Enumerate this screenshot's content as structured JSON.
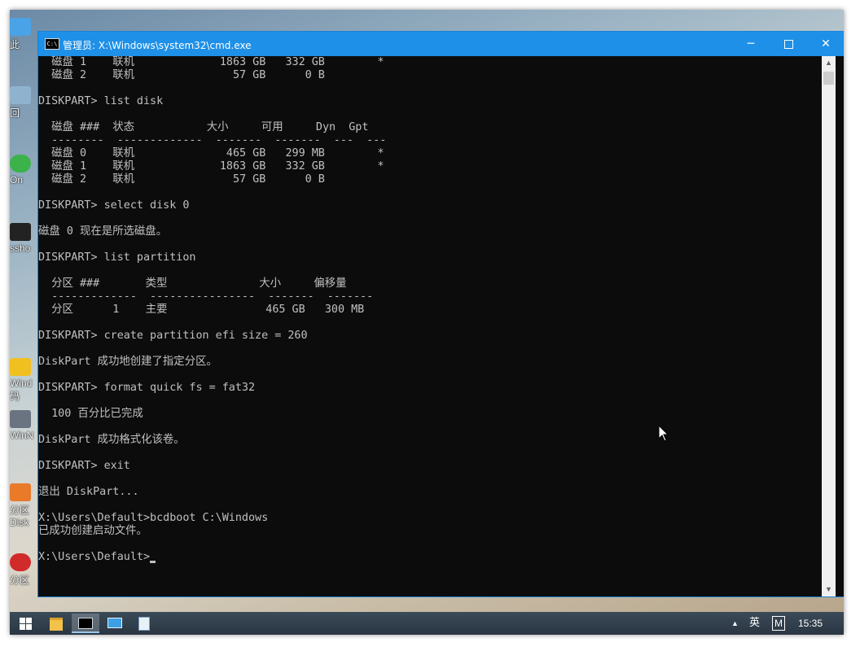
{
  "window": {
    "title": "管理员: X:\\Windows\\system32\\cmd.exe",
    "icon": "cmd-icon",
    "controls": {
      "minimize": "─",
      "maximize": "□",
      "close": "✕"
    }
  },
  "console": {
    "lines": [
      "  磁盘 1    联机             1863 GB   332 GB        *",
      "  磁盘 2    联机               57 GB      0 B",
      "",
      "DISKPART> list disk",
      "",
      "  磁盘 ###  状态           大小     可用     Dyn  Gpt",
      "  --------  -------------  -------  -------  ---  ---",
      "  磁盘 0    联机              465 GB   299 MB        *",
      "  磁盘 1    联机             1863 GB   332 GB        *",
      "  磁盘 2    联机               57 GB      0 B",
      "",
      "DISKPART> select disk 0",
      "",
      "磁盘 0 现在是所选磁盘。",
      "",
      "DISKPART> list partition",
      "",
      "  分区 ###       类型              大小     偏移量",
      "  -------------  ----------------  -------  -------",
      "  分区      1    主要               465 GB   300 MB",
      "",
      "DISKPART> create partition efi size = 260",
      "",
      "DiskPart 成功地创建了指定分区。",
      "",
      "DISKPART> format quick fs = fat32",
      "",
      "  100 百分比已完成",
      "",
      "DiskPart 成功格式化该卷。",
      "",
      "DISKPART> exit",
      "",
      "退出 DiskPart...",
      "",
      "X:\\Users\\Default>bcdboot C:\\Windows",
      "已成功创建启动文件。",
      "",
      "X:\\Users\\Default>"
    ]
  },
  "desktop": {
    "icons": [
      {
        "label": "此",
        "icon": "this-pc-icon"
      },
      {
        "label": "回",
        "icon": "recycle-bin-icon"
      },
      {
        "label": "On",
        "icon": "onekey-icon"
      },
      {
        "label": "ssho",
        "icon": "screenshot-icon"
      },
      {
        "label": "Wind",
        "icon": "windows-tool-icon"
      },
      {
        "label": "码",
        "icon": "code-icon"
      },
      {
        "label": "WinN",
        "icon": "winntsetup-icon"
      },
      {
        "label": "分区",
        "icon": "partition-tool-icon"
      },
      {
        "label": "Disk",
        "icon": "diskgenius-icon"
      },
      {
        "label": "分区",
        "icon": "partition-assistant-icon"
      }
    ]
  },
  "taskbar": {
    "apps": [
      {
        "name": "file-explorer",
        "icon": "folder-icon"
      },
      {
        "name": "cmd",
        "icon": "cmd-icon",
        "active": true
      },
      {
        "name": "this-pc",
        "icon": "computer-icon"
      },
      {
        "name": "notepad",
        "icon": "notepad-icon"
      }
    ],
    "tray": {
      "chevron": "▲",
      "language": "英",
      "ime": "M",
      "clock": "15:35"
    }
  },
  "colors": {
    "titlebar": "#1e90e8",
    "console_bg": "#0c0c0c",
    "console_fg": "#c0c0c0",
    "taskbar": "#2f3b47"
  }
}
